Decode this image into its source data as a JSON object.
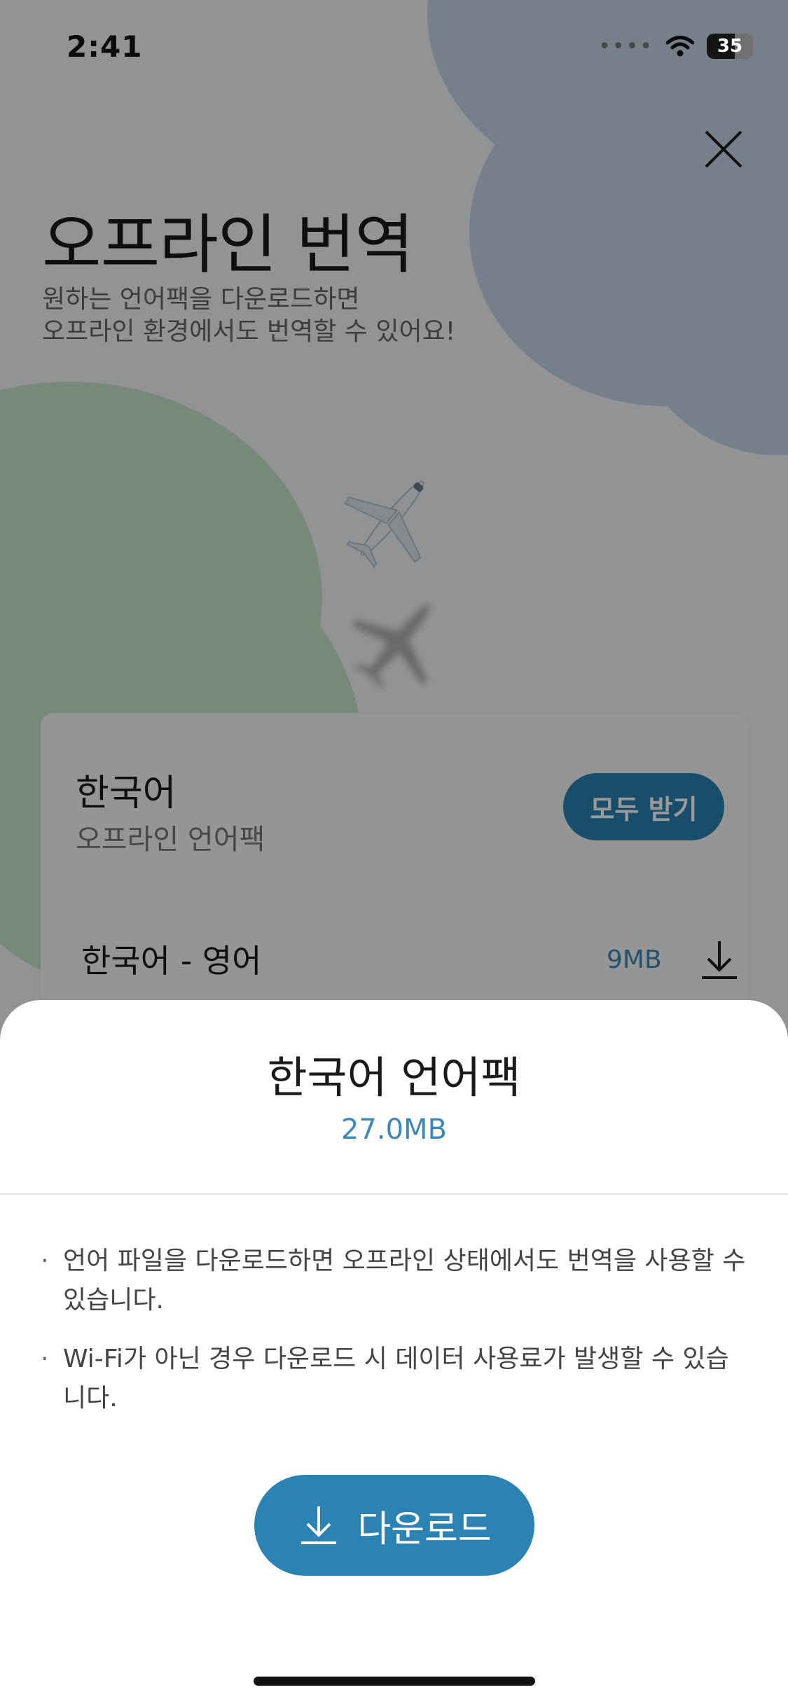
{
  "status_bar": {
    "time": "2:41",
    "battery": "35"
  },
  "header": {
    "title": "오프라인 번역",
    "subtitle_lines": [
      "원하는 언어팩을 다운로드하면",
      "오프라인 환경에서도 번역할 수 있어요!"
    ]
  },
  "card": {
    "title": "한국어",
    "subtitle": "오프라인 언어팩",
    "receive_all_label": "모두 받기",
    "pairs": [
      {
        "label": "한국어 - 영어",
        "size": "9MB"
      }
    ]
  },
  "sheet": {
    "title": "한국어 언어팩",
    "size": "27.0MB",
    "bullet": "·",
    "notes": [
      "언어 파일을 다운로드하면 오프라인 상태에서도 번역을 사용할 수 있습니다.",
      "Wi-Fi가 아닌 경우 다운로드 시 데이터 사용료가 발생할 수 있습니다."
    ],
    "download_label": "다운로드"
  },
  "colors": {
    "accent": "#2a83b3",
    "accent_text": "#3d88b6",
    "blob_blue": "#c4d5e6",
    "blob_green": "#c9e4cf"
  },
  "icons": [
    "close-icon",
    "airplane-icon",
    "download-icon",
    "wifi-icon",
    "battery-icon"
  ]
}
